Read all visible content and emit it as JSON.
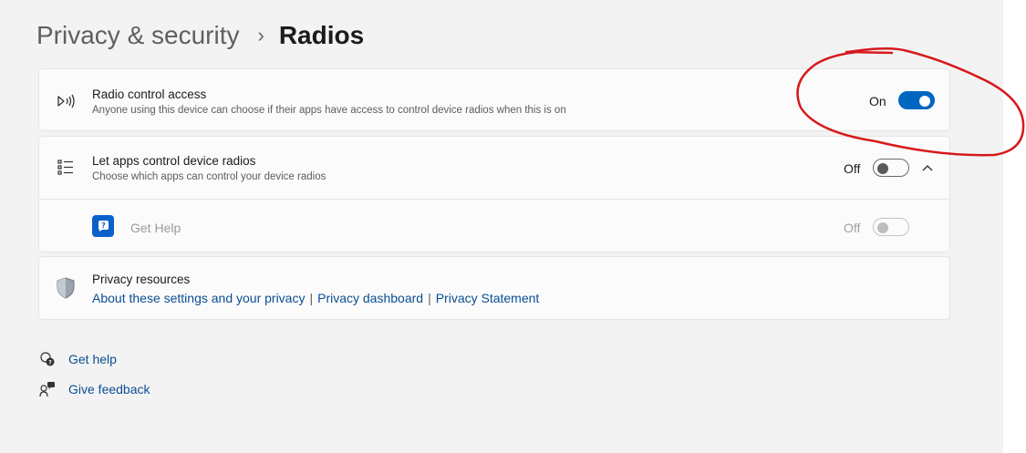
{
  "breadcrumb": {
    "parent": "Privacy & security",
    "separator": "›",
    "current": "Radios"
  },
  "radio_control": {
    "title": "Radio control access",
    "description": "Anyone using this device can choose if their apps have access to control device radios when this is on",
    "state_label": "On",
    "toggle_on": true
  },
  "apps_control": {
    "title": "Let apps control device radios",
    "description": "Choose which apps can control your device radios",
    "state_label": "Off",
    "toggle_on": false,
    "expanded": true,
    "apps": [
      {
        "name": "Get Help",
        "state_label": "Off",
        "enabled": false
      }
    ]
  },
  "privacy_resources": {
    "title": "Privacy resources",
    "links": [
      "About these settings and your privacy",
      "Privacy dashboard",
      "Privacy Statement"
    ],
    "separator": "|"
  },
  "footer": {
    "get_help": "Get help",
    "give_feedback": "Give feedback"
  },
  "colors": {
    "accent": "#0067c0",
    "link": "#0a4e91",
    "annotation": "#d7191c"
  }
}
